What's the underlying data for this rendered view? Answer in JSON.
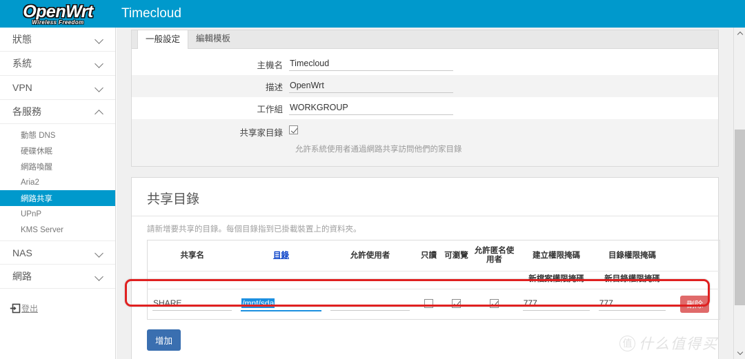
{
  "header": {
    "logo_main": "OpenWrt",
    "logo_sub": "Wireless Freedom",
    "title": "Timecloud",
    "brand_color": "#0099cc"
  },
  "sidebar": {
    "items": [
      {
        "label": "狀態",
        "type": "group",
        "expanded": false
      },
      {
        "label": "系統",
        "type": "group",
        "expanded": false
      },
      {
        "label": "VPN",
        "type": "group",
        "expanded": false
      },
      {
        "label": "各服務",
        "type": "group",
        "expanded": true
      }
    ],
    "services_children": [
      {
        "label": "動態 DNS",
        "active": false
      },
      {
        "label": "硬碟休眠",
        "active": false
      },
      {
        "label": "網路喚醒",
        "active": false
      },
      {
        "label": "Aria2",
        "active": false
      },
      {
        "label": "網路共享",
        "active": true
      },
      {
        "label": "UPnP",
        "active": false
      },
      {
        "label": "KMS Server",
        "active": false
      }
    ],
    "items_after": [
      {
        "label": "NAS",
        "type": "group",
        "expanded": false
      },
      {
        "label": "網路",
        "type": "group",
        "expanded": false
      }
    ],
    "logout_label": "登出",
    "active_color": "#0099cc"
  },
  "settings_panel": {
    "tabs": [
      {
        "label": "一般設定",
        "active": true
      },
      {
        "label": "編輯模板",
        "active": false
      }
    ],
    "fields": [
      {
        "label": "主機名",
        "value": "Timecloud"
      },
      {
        "label": "描述",
        "value": "OpenWrt"
      },
      {
        "label": "工作組",
        "value": "WORKGROUP"
      }
    ],
    "home_share": {
      "label": "共享家目錄",
      "checked": true,
      "help": "允許系統使用者通過網路共享訪問他們的家目錄"
    }
  },
  "shares_panel": {
    "title": "共享目錄",
    "description": "請新增要共享的目錄。每個目錄指到已掛載裝置上的資料夾。",
    "columns": [
      "共享名",
      "目錄",
      "允許使用者",
      "只讀",
      "可瀏覽",
      "允許匿名使用者",
      "建立權限掩碼",
      "目錄權限掩碼",
      ""
    ],
    "subheaders": [
      "",
      "",
      "",
      "",
      "",
      "",
      "新檔案權限掩碼",
      "新目錄權限掩碼",
      ""
    ],
    "rows": [
      {
        "share_name": "SHARE",
        "path": "/mnt/sda",
        "path_selected": true,
        "allowed_users": "",
        "read_only": false,
        "browseable": true,
        "allow_guests": true,
        "create_mask": "777",
        "dir_mask": "777",
        "delete_label": "刪除"
      }
    ],
    "add_label": "增加",
    "delete_color": "#e06a6a",
    "add_color": "#3a6fb0"
  },
  "annotation": {
    "color": "#e02020"
  },
  "watermark": {
    "badge": "值",
    "text": "什么值得买"
  }
}
